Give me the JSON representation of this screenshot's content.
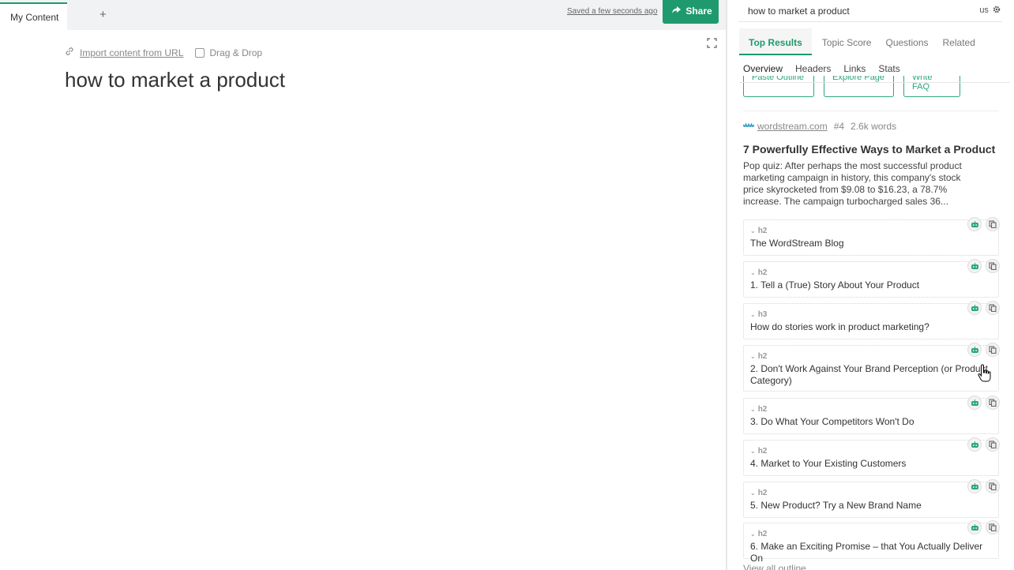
{
  "editor": {
    "tab_label": "My Content",
    "add_tab": "+",
    "saved_text": "Saved a few seconds ago",
    "share_label": "Share",
    "import_label": "Import content from URL",
    "drag_drop_label": "Drag & Drop",
    "title": "how to market a product"
  },
  "panel": {
    "search_value": "how to market a product",
    "country": "us",
    "main_tabs": [
      {
        "label": "Top Results",
        "active": true
      },
      {
        "label": "Topic Score",
        "active": false
      },
      {
        "label": "Questions",
        "active": false
      },
      {
        "label": "Related",
        "active": false
      }
    ],
    "sub_tabs": [
      {
        "label": "Overview",
        "active": true
      },
      {
        "label": "Headers",
        "active": false
      },
      {
        "label": "Links",
        "active": false
      },
      {
        "label": "Stats",
        "active": false
      }
    ],
    "action_buttons": [
      "Paste Outline",
      "Explore Page",
      "Write FAQ"
    ],
    "result": {
      "domain": "wordstream.com",
      "rank": "#4",
      "words": "2.6k words",
      "title": "7 Powerfully Effective Ways to Market a Product",
      "snippet": "Pop quiz: After perhaps the most successful product marketing campaign in history, this company's stock price skyrocketed from $9.08 to $16.23, a 78.7% increase. The campaign turbocharged sales 36..."
    },
    "headings": [
      {
        "tag": "h2",
        "text": "The WordStream Blog"
      },
      {
        "tag": "h2",
        "text": "1. Tell a (True) Story About Your Product"
      },
      {
        "tag": "h3",
        "text": "How do stories work in product marketing?"
      },
      {
        "tag": "h2",
        "text": "2. Don't Work Against Your Brand Perception (or Product Category)"
      },
      {
        "tag": "h2",
        "text": "3. Do What Your Competitors Won't Do"
      },
      {
        "tag": "h2",
        "text": "4. Market to Your Existing Customers"
      },
      {
        "tag": "h2",
        "text": "5. New Product? Try a New Brand Name"
      },
      {
        "tag": "h2",
        "text": "6. Make an Exciting Promise – that You Actually Deliver On"
      }
    ],
    "footer_link": "View all outline"
  },
  "colors": {
    "accent": "#1c9b6b",
    "share_bg": "#1f9a6e"
  },
  "icons": [
    "link-icon",
    "expand-icon",
    "share-icon",
    "settings-icon",
    "robot-icon",
    "copy-icon",
    "chevron-down-icon",
    "hand-cursor-icon"
  ]
}
